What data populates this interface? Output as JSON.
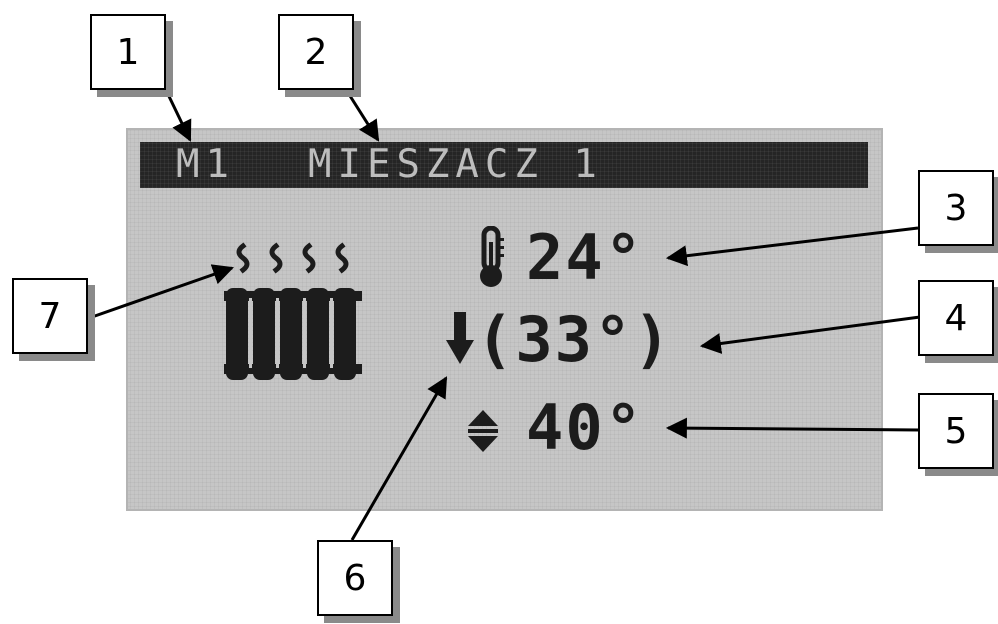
{
  "lcd": {
    "header": {
      "mixer_code": "M1",
      "mixer_name": "MIESZACZ 1"
    },
    "current_temp": "24°",
    "preset_temp": "(33°)",
    "setpoint_temp": "40°"
  },
  "callouts": [
    "1",
    "2",
    "3",
    "4",
    "5",
    "6",
    "7"
  ],
  "colors": {
    "lcd_background": "#c6c6c6",
    "lcd_header": "#252525",
    "lcd_pixels": "#1c1c1c"
  }
}
